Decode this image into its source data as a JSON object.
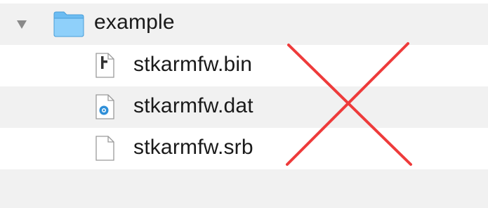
{
  "folder": {
    "name": "example",
    "expanded": true,
    "icon": "folder-icon",
    "color": "#5ab2ef"
  },
  "files": [
    {
      "name": "stkarmfw.bin",
      "icon": "executable-file-icon"
    },
    {
      "name": "stkarmfw.dat",
      "icon": "quicktime-file-icon"
    },
    {
      "name": "stkarmfw.srb",
      "icon": "blank-document-icon"
    }
  ],
  "overlay": {
    "mark": "red-x-mark",
    "color": "#ee3b3b"
  }
}
